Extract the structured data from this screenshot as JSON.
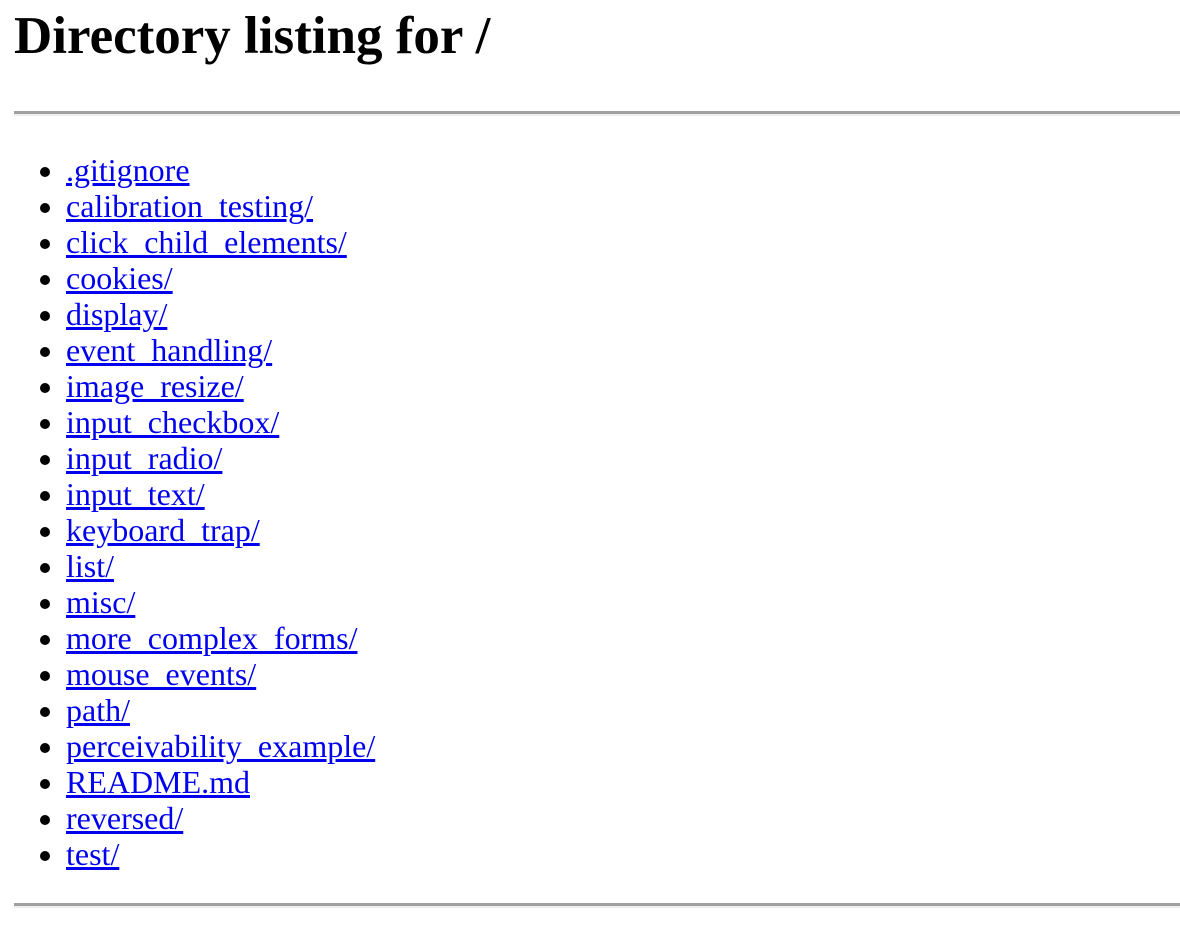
{
  "document": {
    "title": "Directory listing for /",
    "heading": "Directory listing for /",
    "background_color": "#ffffff",
    "link_color": "#0000ee",
    "rule_color": "#a0a0a0",
    "text_color": "#000000"
  },
  "rules": {
    "top_divider": "horizontal-rule",
    "bottom_divider": "horizontal-rule"
  },
  "listing": {
    "entries": [
      {
        "label": ".gitignore",
        "type": "file"
      },
      {
        "label": "calibration_testing/",
        "type": "directory"
      },
      {
        "label": "click_child_elements/",
        "type": "directory"
      },
      {
        "label": "cookies/",
        "type": "directory"
      },
      {
        "label": "display/",
        "type": "directory"
      },
      {
        "label": "event_handling/",
        "type": "directory"
      },
      {
        "label": "image_resize/",
        "type": "directory"
      },
      {
        "label": "input_checkbox/",
        "type": "directory"
      },
      {
        "label": "input_radio/",
        "type": "directory"
      },
      {
        "label": "input_text/",
        "type": "directory"
      },
      {
        "label": "keyboard_trap/",
        "type": "directory"
      },
      {
        "label": "list/",
        "type": "directory"
      },
      {
        "label": "misc/",
        "type": "directory"
      },
      {
        "label": "more_complex_forms/",
        "type": "directory"
      },
      {
        "label": "mouse_events/",
        "type": "directory"
      },
      {
        "label": "path/",
        "type": "directory"
      },
      {
        "label": "perceivability_example/",
        "type": "directory"
      },
      {
        "label": "README.md",
        "type": "file"
      },
      {
        "label": "reversed/",
        "type": "directory"
      },
      {
        "label": "test/",
        "type": "directory"
      }
    ]
  }
}
